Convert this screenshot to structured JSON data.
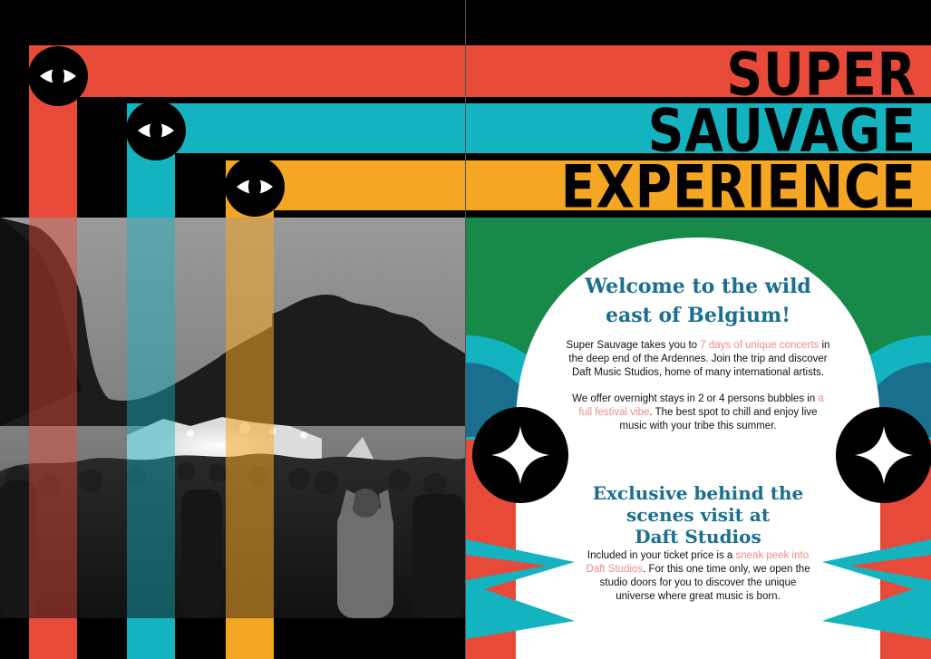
{
  "colors": {
    "red": "#e84a3a",
    "teal": "#13b3bf",
    "yellow": "#f5a623",
    "green": "#178a4a",
    "navy": "#1a6f8f",
    "black": "#000000",
    "highlight": "#f08a8a"
  },
  "icons": {
    "eye": "eye-icon",
    "star": "sparkle-star-icon"
  },
  "title": {
    "line1": "SUPER",
    "line2": "SAUVAGE",
    "line3": "EXPERIENCE"
  },
  "welcome": {
    "heading_line1": "Welcome to the wild",
    "heading_line2": "east of Belgium!",
    "p1_before": "Super Sauvage takes you to ",
    "p1_highlight": "7 days of unique concerts",
    "p1_after": " in the deep end of the Ardennes. Join the trip and discover Daft Music Studios, home of many international artists.",
    "p2_before": "We offer overnight stays in 2 or 4 persons bubbles in ",
    "p2_highlight": "a full festival vibe",
    "p2_after": ". The best spot to chill and enjoy live music with your tribe this summer."
  },
  "exclusive": {
    "heading_line1": "Exclusive behind the",
    "heading_line2": "scenes visit at",
    "heading_line3": "Daft Studios",
    "p_before": "Included in your ticket price is a ",
    "p_highlight": "sneak peek into Daft Studios",
    "p_after": ". For this one time only, we open the studio doors for you to discover the unique universe where great music is born."
  }
}
